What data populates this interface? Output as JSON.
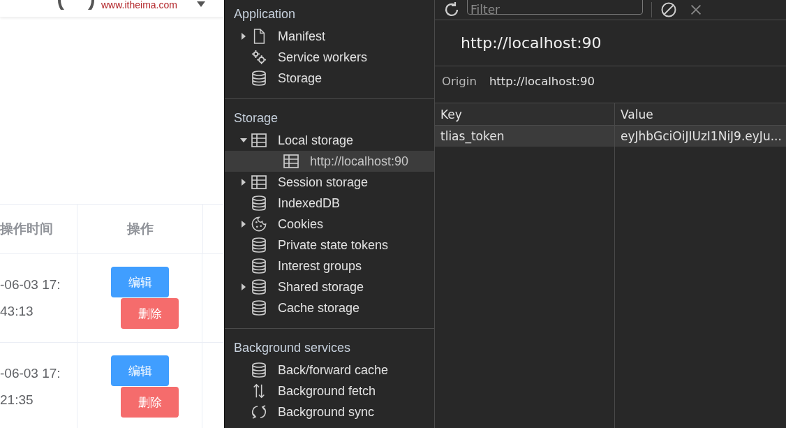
{
  "page": {
    "header": {
      "site_url": "www.itheima.com"
    },
    "table": {
      "columns": [
        "操作时间",
        "操作"
      ],
      "rows": [
        {
          "time": "-06-03 17:43:13",
          "actions": [
            {
              "label": "编辑",
              "kind": "edit"
            },
            {
              "label": "删除",
              "kind": "delete"
            }
          ]
        },
        {
          "time": "-06-03 17:21:35",
          "actions": [
            {
              "label": "编辑",
              "kind": "edit"
            },
            {
              "label": "删除",
              "kind": "delete"
            }
          ]
        }
      ]
    }
  },
  "devtools": {
    "sidebar": {
      "sections": [
        {
          "title": "Application",
          "items": [
            {
              "label": "Manifest",
              "kind": "file",
              "expanded": false,
              "selected": false
            },
            {
              "label": "Service workers",
              "kind": "gears",
              "selected": false
            },
            {
              "label": "Storage",
              "kind": "database",
              "selected": false
            }
          ]
        },
        {
          "title": "Storage",
          "items": [
            {
              "label": "Local storage",
              "kind": "table",
              "expanded": true,
              "selected": false,
              "children": [
                {
                  "label": "http://localhost:90",
                  "kind": "table",
                  "selected": true
                }
              ]
            },
            {
              "label": "Session storage",
              "kind": "table",
              "expanded": false,
              "selected": false
            },
            {
              "label": "IndexedDB",
              "kind": "database",
              "selected": false
            },
            {
              "label": "Cookies",
              "kind": "cookie",
              "expanded": false,
              "selected": false
            },
            {
              "label": "Private state tokens",
              "kind": "database",
              "selected": false
            },
            {
              "label": "Interest groups",
              "kind": "database",
              "selected": false
            },
            {
              "label": "Shared storage",
              "kind": "database",
              "expanded": false,
              "selected": false
            },
            {
              "label": "Cache storage",
              "kind": "database",
              "selected": false
            }
          ]
        },
        {
          "title": "Background services",
          "items": [
            {
              "label": "Back/forward cache",
              "kind": "database",
              "selected": false
            },
            {
              "label": "Background fetch",
              "kind": "updown",
              "selected": false
            },
            {
              "label": "Background sync",
              "kind": "sync",
              "selected": false
            }
          ]
        }
      ]
    },
    "toolbar": {
      "filter": {
        "placeholder": "Filter"
      }
    },
    "origin_title": "http://localhost:90",
    "origin": {
      "label": "Origin",
      "value": "http://localhost:90"
    },
    "table": {
      "columns": [
        "Key",
        "Value"
      ],
      "rows": [
        {
          "key": "tlias_token",
          "value": "eyJhbGciOiJIUzI1NiJ9.eyJu...",
          "selected": true
        }
      ]
    }
  }
}
